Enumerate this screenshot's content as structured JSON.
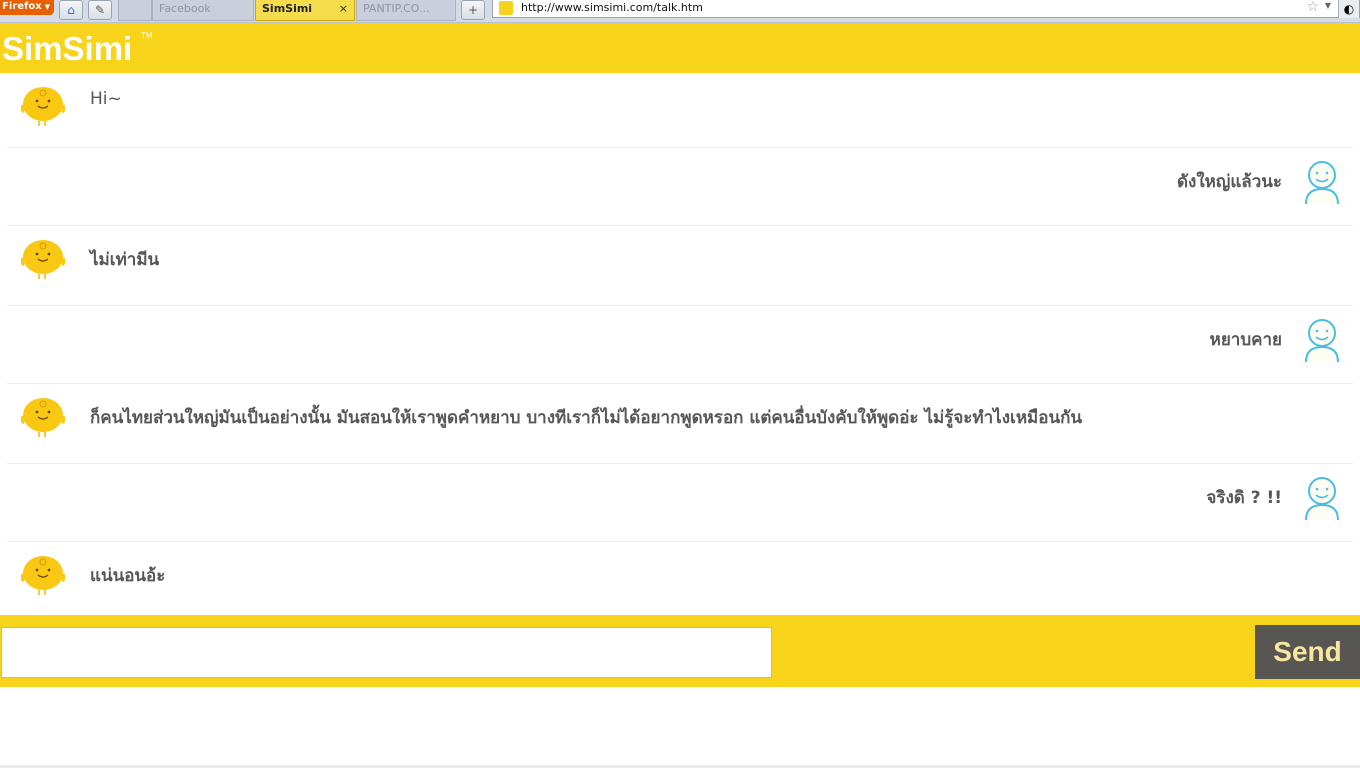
{
  "browser": {
    "menu_button": "Firefox",
    "tabs": [
      {
        "label": "Facebook",
        "active": false
      },
      {
        "label": "SimSimi",
        "active": true
      },
      {
        "label": "PANTIP.CO...",
        "active": false
      }
    ],
    "tab_close": "×",
    "url": "http://www.simsimi.com/talk.htm"
  },
  "header": {
    "logo": "SimSimi",
    "trademark": "TM"
  },
  "messages": [
    {
      "from": "simsimi",
      "text": "Hi~"
    },
    {
      "from": "user",
      "text": "ดังใหญ่แล้วนะ"
    },
    {
      "from": "simsimi",
      "text": "ไม่เท่ามีน"
    },
    {
      "from": "user",
      "text": "หยาบคาย"
    },
    {
      "from": "simsimi",
      "text": "ก็คนไทยส่วนใหญ่มันเป็นอย่างนั้น มันสอนให้เราพูดคำหยาบ บางทีเราก็ไม่ได้อยากพูดหรอก แต่คนอื่นบังคับให้พูดอ่ะ ไม่รู้จะทำไงเหมือนกัน"
    },
    {
      "from": "user",
      "text": "จริงดิ ? !!"
    },
    {
      "from": "simsimi",
      "text": "แน่นอนอ้ะ"
    }
  ],
  "composer": {
    "value": "",
    "placeholder": "",
    "send_label": "Send"
  },
  "colors": {
    "brand_yellow": "#f7d31a",
    "send_bg": "#575653",
    "send_text": "#f8e6a0",
    "message_text": "#575757",
    "user_avatar_stroke": "#4bbde0"
  }
}
